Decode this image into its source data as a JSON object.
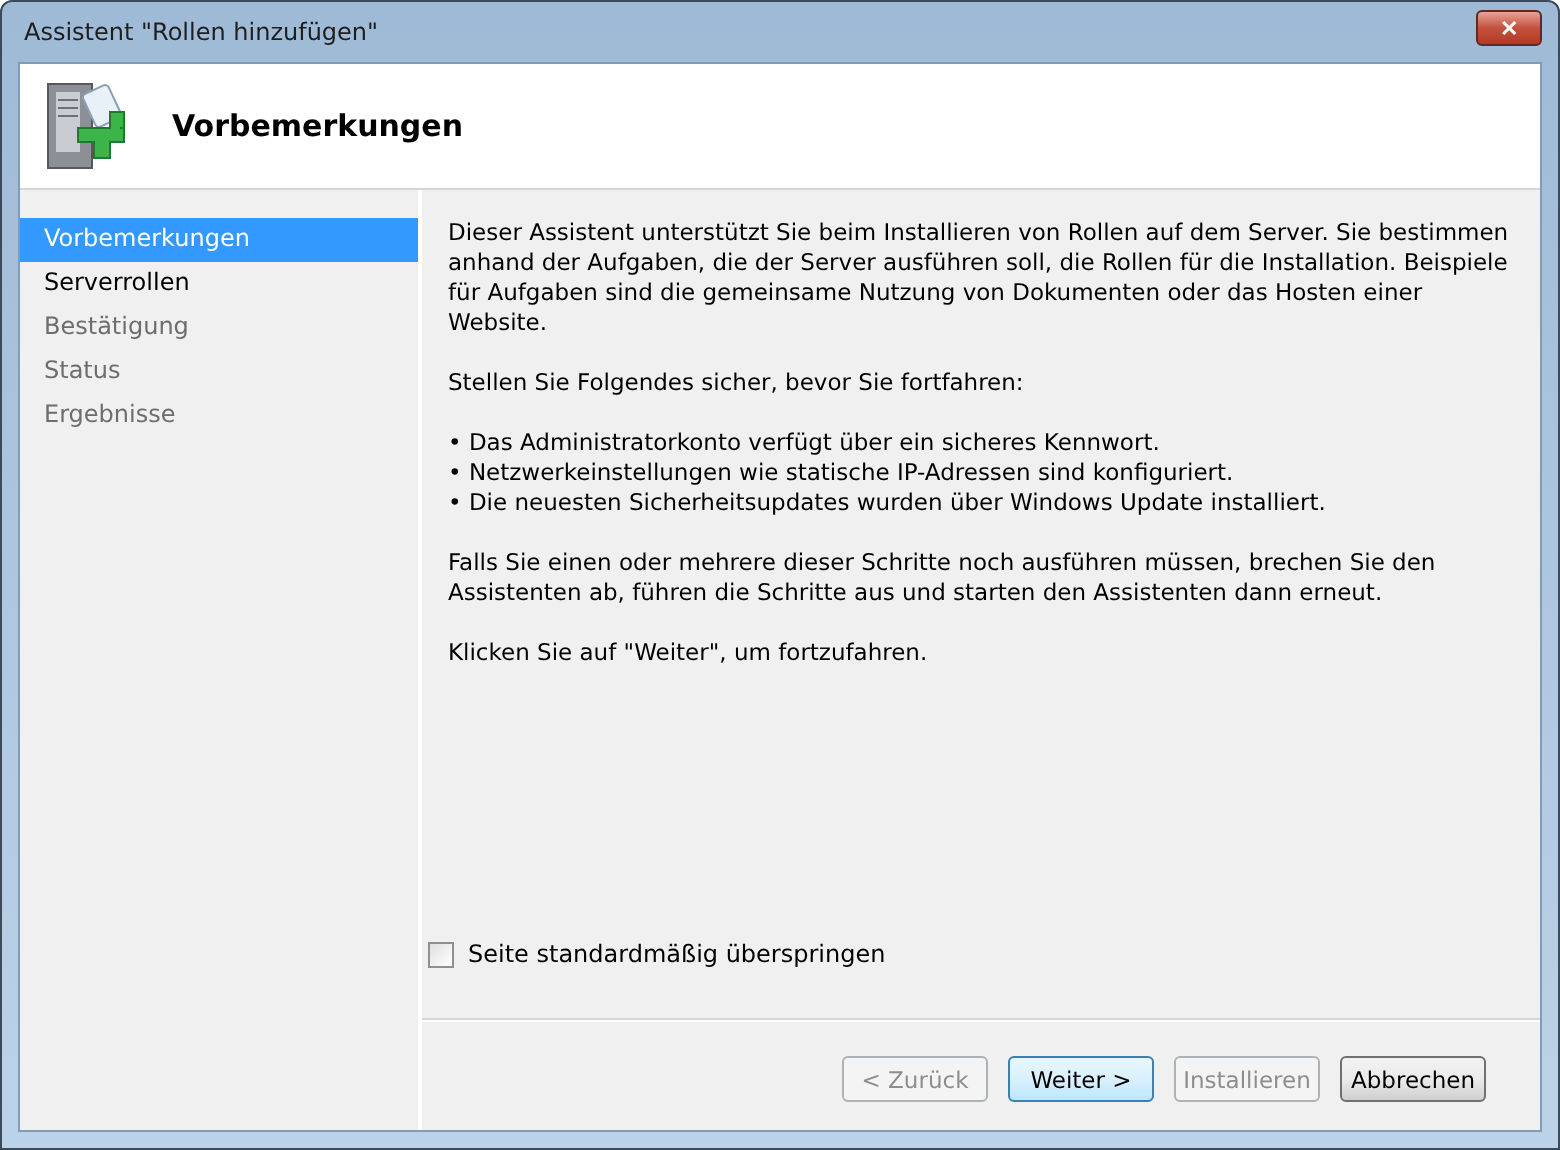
{
  "window": {
    "title": "Assistent \"Rollen hinzufügen\"",
    "close": "✕"
  },
  "header": {
    "title": "Vorbemerkungen"
  },
  "sidebar": {
    "items": [
      {
        "label": "Vorbemerkungen",
        "selected": true,
        "disabled": false
      },
      {
        "label": "Serverrollen",
        "selected": false,
        "disabled": false
      },
      {
        "label": "Bestätigung",
        "selected": false,
        "disabled": true
      },
      {
        "label": "Status",
        "selected": false,
        "disabled": true
      },
      {
        "label": "Ergebnisse",
        "selected": false,
        "disabled": true
      }
    ]
  },
  "content": {
    "paragraphs": [
      {
        "kind": "text",
        "text": "Dieser Assistent unterstützt Sie beim Installieren von Rollen auf dem Server. Sie bestimmen anhand der Aufgaben, die der Server ausführen soll, die Rollen für die Installation. Beispiele für Aufgaben sind die gemeinsame Nutzung von Dokumenten oder das Hosten einer Website."
      },
      {
        "kind": "text",
        "text": "Stellen Sie Folgendes sicher, bevor Sie fortfahren:"
      },
      {
        "kind": "bullets",
        "items": [
          "• Das Administratorkonto verfügt über ein sicheres Kennwort.",
          "• Netzwerkeinstellungen wie statische IP-Adressen sind konfiguriert.",
          "• Die neuesten Sicherheitsupdates wurden über Windows Update installiert."
        ]
      },
      {
        "kind": "text",
        "text": "Falls Sie einen oder mehrere dieser Schritte noch ausführen müssen, brechen Sie den Assistenten ab, führen die Schritte aus und starten den Assistenten dann erneut."
      },
      {
        "kind": "text",
        "text": "Klicken Sie auf \"Weiter\", um fortzufahren."
      }
    ],
    "skip_checkbox": {
      "label": "Seite standardmäßig überspringen",
      "checked": false
    }
  },
  "buttons": [
    {
      "label": "< Zurück",
      "disabled": true,
      "default": false
    },
    {
      "label": "Weiter >",
      "disabled": false,
      "default": true
    },
    {
      "label": "Installieren",
      "disabled": true,
      "default": false
    },
    {
      "label": "Abbrechen",
      "disabled": false,
      "default": false
    }
  ]
}
